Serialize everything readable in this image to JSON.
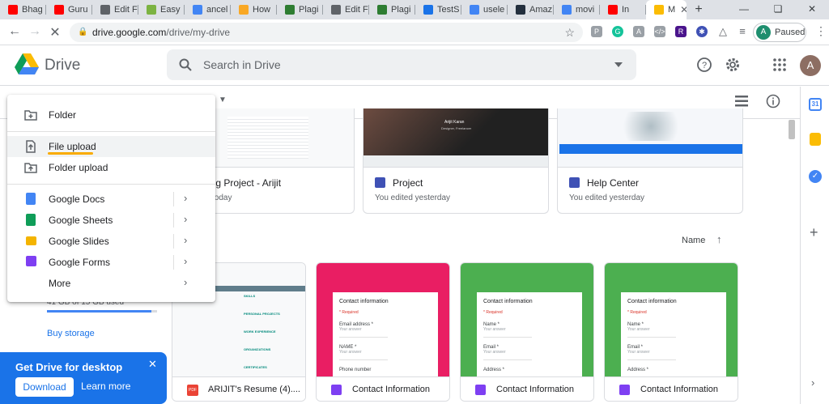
{
  "browser": {
    "tabs": [
      {
        "label": "Bhag",
        "icon": "youtube-icon",
        "color": "#ff0000"
      },
      {
        "label": "Guru",
        "icon": "youtube-icon",
        "color": "#ff0000"
      },
      {
        "label": "Edit F",
        "icon": "globe-icon",
        "color": "#5f6368"
      },
      {
        "label": "Easy",
        "icon": "easy-icon",
        "color": "#7cb342"
      },
      {
        "label": "ancel",
        "icon": "google-icon",
        "color": "#4285f4"
      },
      {
        "label": "How",
        "icon": "how-icon",
        "color": "#f9a825"
      },
      {
        "label": "Plagi",
        "icon": "plagiarism-icon",
        "color": "#2e7d32"
      },
      {
        "label": "Edit F",
        "icon": "globe-icon",
        "color": "#5f6368"
      },
      {
        "label": "Plagi",
        "icon": "plagiarism-icon",
        "color": "#2e7d32"
      },
      {
        "label": "TestS",
        "icon": "tests-icon",
        "color": "#1a73e8"
      },
      {
        "label": "usele",
        "icon": "google-icon",
        "color": "#4285f4"
      },
      {
        "label": "Amaz",
        "icon": "amazon-icon",
        "color": "#232f3e"
      },
      {
        "label": "movi",
        "icon": "google-icon",
        "color": "#4285f4"
      },
      {
        "label": "In",
        "icon": "youtube-icon",
        "color": "#ff0000"
      },
      {
        "label": "M",
        "icon": "drive-icon",
        "color": "#fbbc04",
        "active": true
      }
    ],
    "new_tab": "+",
    "url_host": "drive.google.com",
    "url_path": "/drive/my-drive",
    "profile_initial": "A",
    "profile_status": "Paused"
  },
  "header": {
    "app_name": "Drive",
    "search_placeholder": "Search in Drive",
    "avatar_initial": "A"
  },
  "new_menu": {
    "items": [
      {
        "label": "Folder",
        "icon": "new-folder-icon"
      },
      {
        "label": "File upload",
        "icon": "file-upload-icon"
      },
      {
        "label": "Folder upload",
        "icon": "folder-upload-icon"
      },
      {
        "label": "Google Docs",
        "icon": "docs-icon",
        "color": "#4285f4"
      },
      {
        "label": "Google Sheets",
        "icon": "sheets-icon",
        "color": "#0f9d58"
      },
      {
        "label": "Google Slides",
        "icon": "slides-icon",
        "color": "#f4b400"
      },
      {
        "label": "Google Forms",
        "icon": "forms-icon",
        "color": "#7e3ff2"
      },
      {
        "label": "More",
        "icon": ""
      }
    ],
    "highlight_color": "#f9ab00"
  },
  "sidebar": {
    "storage_text": "41 GB of 15 GB used",
    "storage_fraction": 0.95,
    "buy_storage": "Buy storage",
    "promo": {
      "title": "Get Drive for desktop",
      "download": "Download",
      "learn_more": "Learn more"
    }
  },
  "main": {
    "title_tail": "e",
    "quick_access": [
      {
        "name": "ing Project - Arijit",
        "sub": "l today"
      },
      {
        "name": "Project",
        "sub": "You edited yesterday",
        "thumb_title": "Arijit Karan",
        "thumb_sub": "Designer, Freelancer"
      },
      {
        "name": "Help Center",
        "sub": "You edited yesterday"
      }
    ],
    "sort_label": "Name",
    "files": [
      {
        "name": "ARIJIT's Resume (4)....",
        "type": "pdf"
      },
      {
        "name": "Contact Information",
        "type": "form",
        "color": "#e91e63"
      },
      {
        "name": "Contact Information",
        "type": "form",
        "color": "#4caf50"
      },
      {
        "name": "Contact Information",
        "type": "form",
        "color": "#4caf50"
      }
    ],
    "resume_sections": [
      "SKILLS",
      "PERSONAL PROJECTS",
      "WORK EXPERIENCE",
      "ORGANIZATIONS",
      "CERTIFICATES"
    ],
    "form_preview": {
      "title": "Contact information",
      "required": "* Required",
      "fields": [
        "Email address *",
        "NAME *",
        "Phone number"
      ],
      "fields_green": [
        "Name *",
        "Email *",
        "Address *"
      ],
      "answer": "Your answer"
    }
  }
}
